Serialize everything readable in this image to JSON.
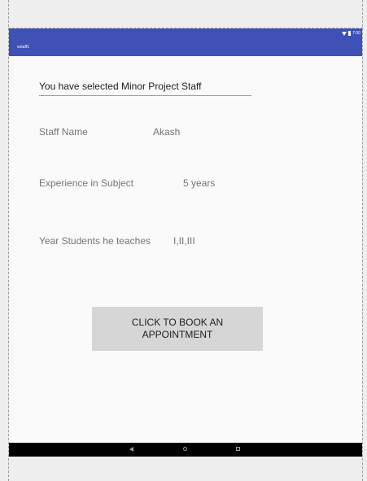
{
  "status_bar": {
    "time": "7:00",
    "icons": [
      "wifi-icon",
      "battery-icon"
    ]
  },
  "app_bar": {
    "title": "estaff1",
    "color": "#3f51b5"
  },
  "selection": {
    "text": "You have selected Minor Project Staff"
  },
  "details": {
    "staff_name_label": "Staff Name",
    "staff_name_value": "Akash",
    "experience_label": "Experience in Subject",
    "experience_value": "5 years",
    "year_label": "Year Students he teaches",
    "year_value": "I,II,III"
  },
  "actions": {
    "book_label": "CLICK TO BOOK AN APPOINTMENT"
  },
  "nav_bar": {
    "icons": [
      "back-icon",
      "home-icon",
      "recents-icon"
    ]
  }
}
